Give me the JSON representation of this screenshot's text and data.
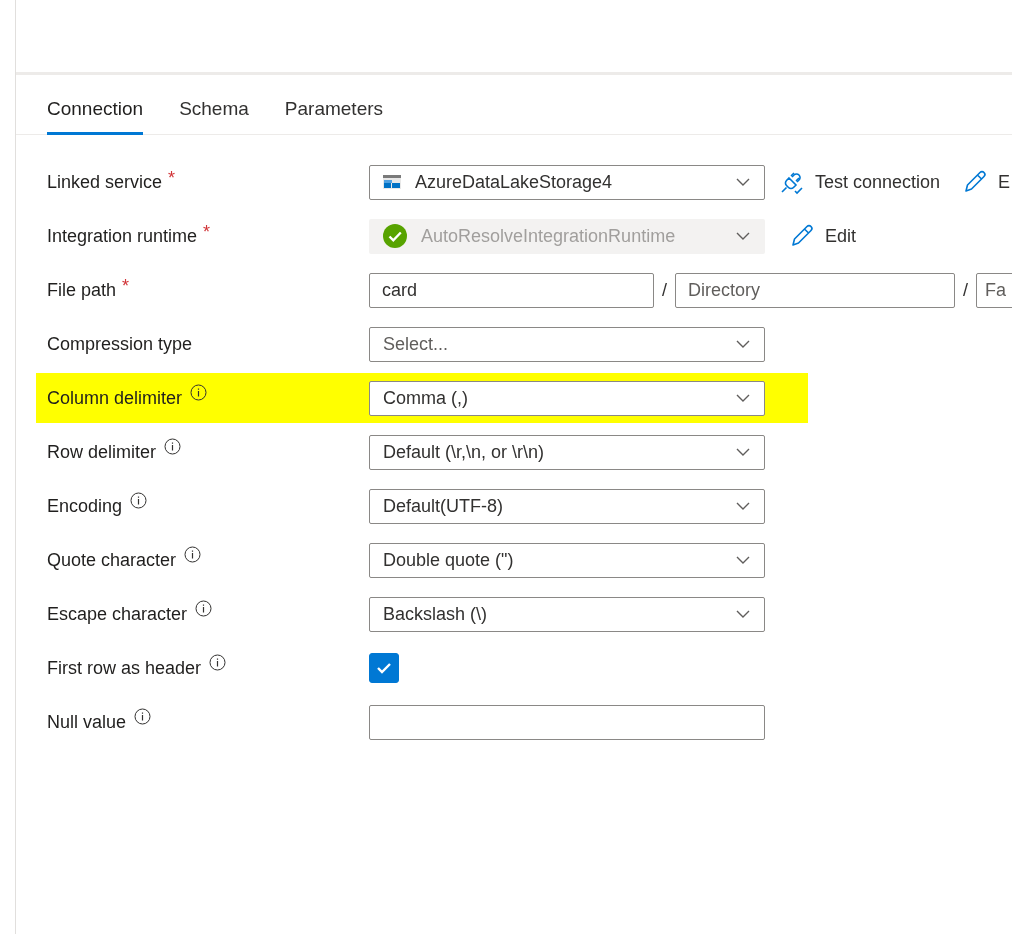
{
  "tabs": [
    {
      "label": "Connection",
      "selected": true
    },
    {
      "label": "Schema",
      "selected": false
    },
    {
      "label": "Parameters",
      "selected": false
    }
  ],
  "fields": [
    {
      "label": "Linked service",
      "required_mark": "*",
      "kind": "service_select",
      "value": "AzureDataLakeStorage4",
      "actions": [
        {
          "kind": "test",
          "label": "Test connection"
        },
        {
          "kind": "edit",
          "label": "E"
        }
      ]
    },
    {
      "label": "Integration runtime",
      "required_mark": "*",
      "kind": "runtime_select",
      "value": "AutoResolveIntegrationRuntime",
      "disabled": true,
      "actions": [
        {
          "kind": "edit",
          "label": "Edit"
        }
      ]
    },
    {
      "label": "File path",
      "required_mark": "*",
      "kind": "path",
      "segments": [
        {
          "value": "card"
        },
        {
          "placeholder": "Directory"
        },
        {
          "placeholder": "Fa"
        }
      ],
      "separators": [
        "/",
        "/"
      ]
    },
    {
      "label": "Compression type",
      "kind": "select",
      "placeholder": "Select..."
    },
    {
      "label": "Column delimiter",
      "info": true,
      "highlighted": true,
      "kind": "select",
      "value": "Comma (,)"
    },
    {
      "label": "Row delimiter",
      "info": true,
      "kind": "select",
      "value": "Default (\\r,\\n, or \\r\\n)"
    },
    {
      "label": "Encoding",
      "info": true,
      "kind": "select",
      "value": "Default(UTF-8)"
    },
    {
      "label": "Quote character",
      "info": true,
      "kind": "select",
      "value": "Double quote (\")"
    },
    {
      "label": "Escape character",
      "info": true,
      "kind": "select",
      "value": "Backslash (\\)"
    },
    {
      "label": "First row as header",
      "info": true,
      "kind": "checkbox",
      "checked": true
    },
    {
      "label": "Null value",
      "info": true,
      "kind": "text"
    }
  ]
}
